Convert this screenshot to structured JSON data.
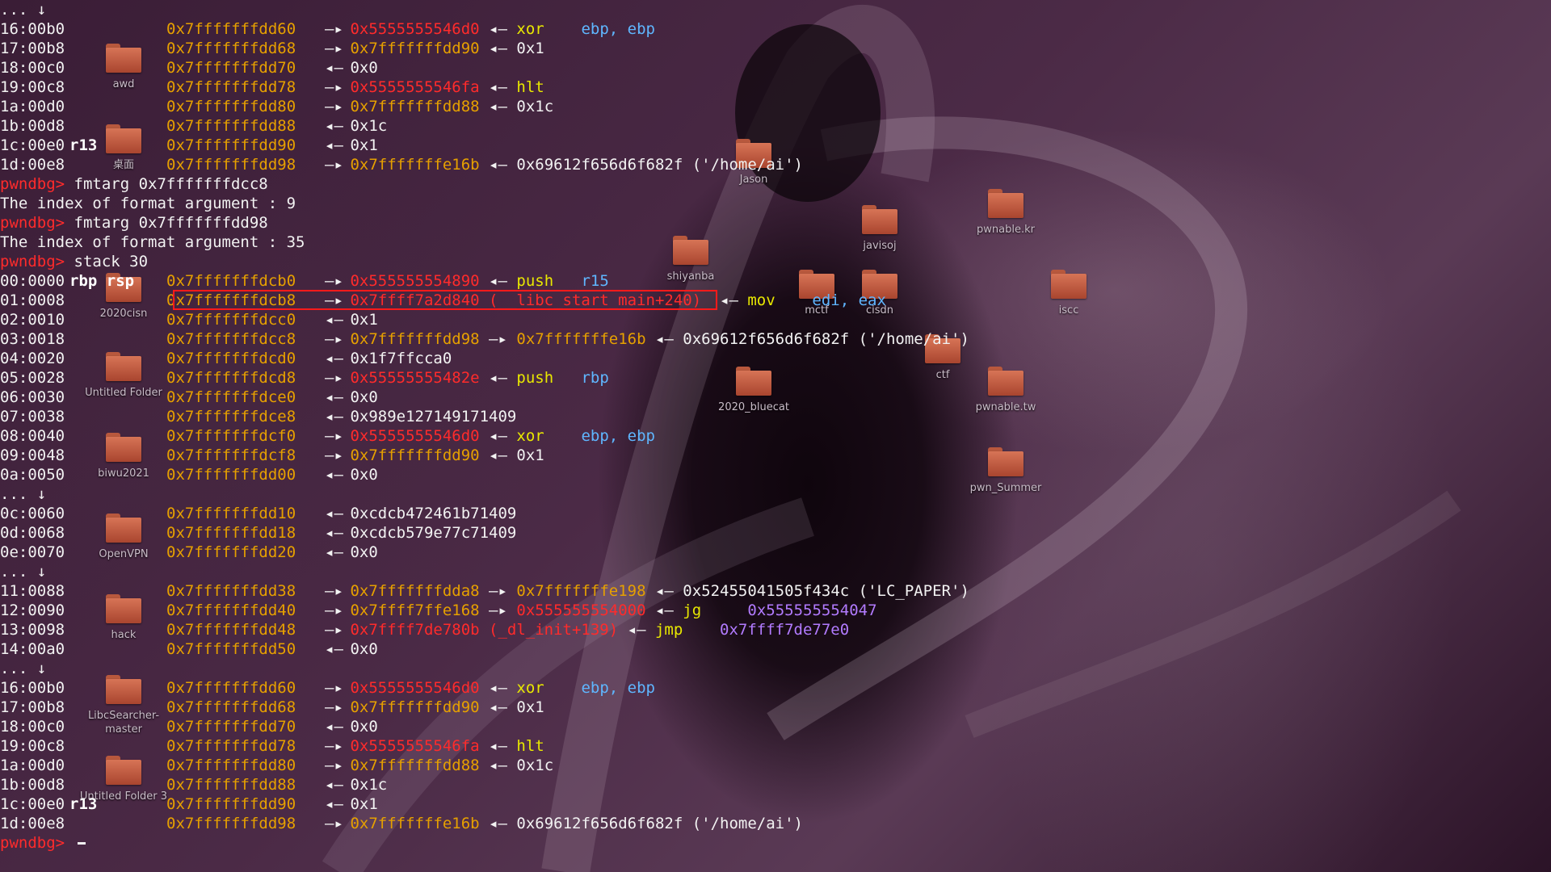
{
  "desktop": {
    "folders": [
      {
        "label": "awd"
      },
      {
        "label": "桌面"
      },
      {
        "label": "2020cisn"
      },
      {
        "label": "Untitled Folder"
      },
      {
        "label": "biwu2021"
      },
      {
        "label": "OpenVPN"
      },
      {
        "label": "hack"
      },
      {
        "label": "LibcSearcher-master"
      },
      {
        "label": "Untitled Folder 3"
      },
      {
        "label": "Jason"
      },
      {
        "label": "shiyanba"
      },
      {
        "label": "javisoj"
      },
      {
        "label": "pwnable.kr"
      },
      {
        "label": "mctf"
      },
      {
        "label": "cisdn"
      },
      {
        "label": "iscc"
      },
      {
        "label": "ctf"
      },
      {
        "label": "2020_bluecat"
      },
      {
        "label": "pwnable.tw"
      },
      {
        "label": "pwn_Summer"
      }
    ]
  },
  "terminal": {
    "colors": {
      "address": "#e6a000",
      "code": "#ff2b2b",
      "instruction": "#e8e800",
      "operand": "#5fb6ff",
      "symbol": "#b27bff",
      "text": "#f2f2f2"
    },
    "highlight_box_color": "#ff1a1a",
    "lines": [
      {
        "kind": "dots",
        "text": "... ↓"
      },
      {
        "kind": "stack",
        "off": "16:00b0",
        "reg": "",
        "addr": "0x7fffffffdd60",
        "arrow": "—▸",
        "parts": [
          {
            "t": "0x5555555546d0",
            "c": "heap"
          },
          {
            "t": " ◂— ",
            "c": "plain"
          },
          {
            "t": "xor",
            "c": "ins"
          },
          {
            "t": "    ebp, ebp",
            "c": "ops"
          }
        ]
      },
      {
        "kind": "stack",
        "off": "17:00b8",
        "reg": "",
        "addr": "0x7fffffffdd68",
        "arrow": "—▸",
        "parts": [
          {
            "t": "0x7fffffffdd90",
            "c": "stk"
          },
          {
            "t": " ◂— ",
            "c": "plain"
          },
          {
            "t": "0x1",
            "c": "plain"
          }
        ]
      },
      {
        "kind": "stack",
        "off": "18:00c0",
        "reg": "",
        "addr": "0x7fffffffdd70",
        "arrow": "◂—",
        "parts": [
          {
            "t": "0x0",
            "c": "plain"
          }
        ]
      },
      {
        "kind": "stack",
        "off": "19:00c8",
        "reg": "",
        "addr": "0x7fffffffdd78",
        "arrow": "—▸",
        "parts": [
          {
            "t": "0x5555555546fa",
            "c": "heap"
          },
          {
            "t": " ◂— ",
            "c": "plain"
          },
          {
            "t": "hlt",
            "c": "ins"
          }
        ]
      },
      {
        "kind": "stack",
        "off": "1a:00d0",
        "reg": "",
        "addr": "0x7fffffffdd80",
        "arrow": "—▸",
        "parts": [
          {
            "t": "0x7fffffffdd88",
            "c": "stk"
          },
          {
            "t": " ◂— ",
            "c": "plain"
          },
          {
            "t": "0x1c",
            "c": "plain"
          }
        ]
      },
      {
        "kind": "stack",
        "off": "1b:00d8",
        "reg": "",
        "addr": "0x7fffffffdd88",
        "arrow": "◂—",
        "parts": [
          {
            "t": "0x1c",
            "c": "plain"
          }
        ]
      },
      {
        "kind": "stack",
        "off": "1c:00e0",
        "reg": "r13",
        "addr": "0x7fffffffdd90",
        "arrow": "◂—",
        "parts": [
          {
            "t": "0x1",
            "c": "plain"
          }
        ]
      },
      {
        "kind": "stack",
        "off": "1d:00e8",
        "reg": "",
        "addr": "0x7fffffffdd98",
        "arrow": "—▸",
        "parts": [
          {
            "t": "0x7fffffffe16b",
            "c": "stk"
          },
          {
            "t": " ◂— ",
            "c": "plain"
          },
          {
            "t": "0x69612f656d6f682f ('/home/ai')",
            "c": "plain"
          }
        ]
      },
      {
        "kind": "cmd",
        "prompt": "pwndbg>",
        "text": " fmtarg 0x7fffffffdcc8"
      },
      {
        "kind": "out",
        "text": "The index of format argument : 9"
      },
      {
        "kind": "cmd",
        "prompt": "pwndbg>",
        "text": " fmtarg 0x7fffffffdd98"
      },
      {
        "kind": "out",
        "text": "The index of format argument : 35"
      },
      {
        "kind": "cmd",
        "prompt": "pwndbg>",
        "text": " stack 30"
      },
      {
        "kind": "stack",
        "off": "00:0000",
        "reg": "rbp rsp",
        "addr": "0x7fffffffdcb0",
        "arrow": "—▸",
        "parts": [
          {
            "t": "0x555555554890",
            "c": "heap"
          },
          {
            "t": " ◂— ",
            "c": "plain"
          },
          {
            "t": "push",
            "c": "ins"
          },
          {
            "t": "   r15",
            "c": "ops"
          }
        ]
      },
      {
        "kind": "stack",
        "off": "01:0008",
        "reg": "",
        "addr": "0x7fffffffdcb8",
        "arrow": "—▸",
        "parts": [
          {
            "t": "0x7ffff7a2d840 (__libc_start_main+240)",
            "c": "heap"
          },
          {
            "t": "  ◂— ",
            "c": "plain"
          },
          {
            "t": "mov",
            "c": "ins"
          },
          {
            "t": "    edi, eax",
            "c": "ops"
          }
        ]
      },
      {
        "kind": "stack",
        "off": "02:0010",
        "reg": "",
        "addr": "0x7fffffffdcc0",
        "arrow": "◂—",
        "parts": [
          {
            "t": "0x1",
            "c": "plain"
          }
        ]
      },
      {
        "kind": "stack",
        "off": "03:0018",
        "reg": "",
        "addr": "0x7fffffffdcc8",
        "arrow": "—▸",
        "parts": [
          {
            "t": "0x7fffffffdd98",
            "c": "stk"
          },
          {
            "t": " —▸ ",
            "c": "plain"
          },
          {
            "t": "0x7fffffffe16b",
            "c": "stk"
          },
          {
            "t": " ◂— ",
            "c": "plain"
          },
          {
            "t": "0x69612f656d6f682f ('/home/ai')",
            "c": "plain"
          }
        ]
      },
      {
        "kind": "stack",
        "off": "04:0020",
        "reg": "",
        "addr": "0x7fffffffdcd0",
        "arrow": "◂—",
        "parts": [
          {
            "t": "0x1f7ffcca0",
            "c": "plain"
          }
        ]
      },
      {
        "kind": "stack",
        "off": "05:0028",
        "reg": "",
        "addr": "0x7fffffffdcd8",
        "arrow": "—▸",
        "parts": [
          {
            "t": "0x55555555482e",
            "c": "heap"
          },
          {
            "t": " ◂— ",
            "c": "plain"
          },
          {
            "t": "push",
            "c": "ins"
          },
          {
            "t": "   rbp",
            "c": "ops"
          }
        ]
      },
      {
        "kind": "stack",
        "off": "06:0030",
        "reg": "",
        "addr": "0x7fffffffdce0",
        "arrow": "◂—",
        "parts": [
          {
            "t": "0x0",
            "c": "plain"
          }
        ]
      },
      {
        "kind": "stack",
        "off": "07:0038",
        "reg": "",
        "addr": "0x7fffffffdce8",
        "arrow": "◂—",
        "parts": [
          {
            "t": "0x989e127149171409",
            "c": "plain"
          }
        ]
      },
      {
        "kind": "stack",
        "off": "08:0040",
        "reg": "",
        "addr": "0x7fffffffdcf0",
        "arrow": "—▸",
        "parts": [
          {
            "t": "0x5555555546d0",
            "c": "heap"
          },
          {
            "t": " ◂— ",
            "c": "plain"
          },
          {
            "t": "xor",
            "c": "ins"
          },
          {
            "t": "    ebp, ebp",
            "c": "ops"
          }
        ]
      },
      {
        "kind": "stack",
        "off": "09:0048",
        "reg": "",
        "addr": "0x7fffffffdcf8",
        "arrow": "—▸",
        "parts": [
          {
            "t": "0x7fffffffdd90",
            "c": "stk"
          },
          {
            "t": " ◂— ",
            "c": "plain"
          },
          {
            "t": "0x1",
            "c": "plain"
          }
        ]
      },
      {
        "kind": "stack",
        "off": "0a:0050",
        "reg": "",
        "addr": "0x7fffffffdd00",
        "arrow": "◂—",
        "parts": [
          {
            "t": "0x0",
            "c": "plain"
          }
        ]
      },
      {
        "kind": "dots",
        "text": "... ↓"
      },
      {
        "kind": "stack",
        "off": "0c:0060",
        "reg": "",
        "addr": "0x7fffffffdd10",
        "arrow": "◂—",
        "parts": [
          {
            "t": "0xcdcb472461b71409",
            "c": "plain"
          }
        ]
      },
      {
        "kind": "stack",
        "off": "0d:0068",
        "reg": "",
        "addr": "0x7fffffffdd18",
        "arrow": "◂—",
        "parts": [
          {
            "t": "0xcdcb579e77c71409",
            "c": "plain"
          }
        ]
      },
      {
        "kind": "stack",
        "off": "0e:0070",
        "reg": "",
        "addr": "0x7fffffffdd20",
        "arrow": "◂—",
        "parts": [
          {
            "t": "0x0",
            "c": "plain"
          }
        ]
      },
      {
        "kind": "dots",
        "text": "... ↓"
      },
      {
        "kind": "stack",
        "off": "11:0088",
        "reg": "",
        "addr": "0x7fffffffdd38",
        "arrow": "—▸",
        "parts": [
          {
            "t": "0x7fffffffdda8",
            "c": "stk"
          },
          {
            "t": " —▸ ",
            "c": "plain"
          },
          {
            "t": "0x7fffffffe198",
            "c": "stk"
          },
          {
            "t": " ◂— ",
            "c": "plain"
          },
          {
            "t": "0x52455041505f434c ('LC_PAPER')",
            "c": "plain"
          }
        ]
      },
      {
        "kind": "stack",
        "off": "12:0090",
        "reg": "",
        "addr": "0x7fffffffdd40",
        "arrow": "—▸",
        "parts": [
          {
            "t": "0x7ffff7ffe168",
            "c": "stk"
          },
          {
            "t": " —▸ ",
            "c": "plain"
          },
          {
            "t": "0x555555554000",
            "c": "heap"
          },
          {
            "t": " ◂— ",
            "c": "plain"
          },
          {
            "t": "jg",
            "c": "ins"
          },
          {
            "t": "     0x555555554047",
            "c": "mag"
          }
        ]
      },
      {
        "kind": "stack",
        "off": "13:0098",
        "reg": "",
        "addr": "0x7fffffffdd48",
        "arrow": "—▸",
        "parts": [
          {
            "t": "0x7ffff7de780b (_dl_init+139)",
            "c": "heap"
          },
          {
            "t": " ◂— ",
            "c": "plain"
          },
          {
            "t": "jmp",
            "c": "ins"
          },
          {
            "t": "    0x7ffff7de77e0",
            "c": "mag"
          }
        ]
      },
      {
        "kind": "stack",
        "off": "14:00a0",
        "reg": "",
        "addr": "0x7fffffffdd50",
        "arrow": "◂—",
        "parts": [
          {
            "t": "0x0",
            "c": "plain"
          }
        ]
      },
      {
        "kind": "dots",
        "text": "... ↓"
      },
      {
        "kind": "stack",
        "off": "16:00b0",
        "reg": "",
        "addr": "0x7fffffffdd60",
        "arrow": "—▸",
        "parts": [
          {
            "t": "0x5555555546d0",
            "c": "heap"
          },
          {
            "t": " ◂— ",
            "c": "plain"
          },
          {
            "t": "xor",
            "c": "ins"
          },
          {
            "t": "    ebp, ebp",
            "c": "ops"
          }
        ]
      },
      {
        "kind": "stack",
        "off": "17:00b8",
        "reg": "",
        "addr": "0x7fffffffdd68",
        "arrow": "—▸",
        "parts": [
          {
            "t": "0x7fffffffdd90",
            "c": "stk"
          },
          {
            "t": " ◂— ",
            "c": "plain"
          },
          {
            "t": "0x1",
            "c": "plain"
          }
        ]
      },
      {
        "kind": "stack",
        "off": "18:00c0",
        "reg": "",
        "addr": "0x7fffffffdd70",
        "arrow": "◂—",
        "parts": [
          {
            "t": "0x0",
            "c": "plain"
          }
        ]
      },
      {
        "kind": "stack",
        "off": "19:00c8",
        "reg": "",
        "addr": "0x7fffffffdd78",
        "arrow": "—▸",
        "parts": [
          {
            "t": "0x5555555546fa",
            "c": "heap"
          },
          {
            "t": " ◂— ",
            "c": "plain"
          },
          {
            "t": "hlt",
            "c": "ins"
          }
        ]
      },
      {
        "kind": "stack",
        "off": "1a:00d0",
        "reg": "",
        "addr": "0x7fffffffdd80",
        "arrow": "—▸",
        "parts": [
          {
            "t": "0x7fffffffdd88",
            "c": "stk"
          },
          {
            "t": " ◂— ",
            "c": "plain"
          },
          {
            "t": "0x1c",
            "c": "plain"
          }
        ]
      },
      {
        "kind": "stack",
        "off": "1b:00d8",
        "reg": "",
        "addr": "0x7fffffffdd88",
        "arrow": "◂—",
        "parts": [
          {
            "t": "0x1c",
            "c": "plain"
          }
        ]
      },
      {
        "kind": "stack",
        "off": "1c:00e0",
        "reg": "r13",
        "addr": "0x7fffffffdd90",
        "arrow": "◂—",
        "parts": [
          {
            "t": "0x1",
            "c": "plain"
          }
        ]
      },
      {
        "kind": "stack",
        "off": "1d:00e8",
        "reg": "",
        "addr": "0x7fffffffdd98",
        "arrow": "—▸",
        "parts": [
          {
            "t": "0x7fffffffe16b",
            "c": "stk"
          },
          {
            "t": " ◂— ",
            "c": "plain"
          },
          {
            "t": "0x69612f656d6f682f ('/home/ai')",
            "c": "plain"
          }
        ]
      },
      {
        "kind": "input",
        "prompt": "pwndbg>",
        "text": " "
      }
    ]
  }
}
